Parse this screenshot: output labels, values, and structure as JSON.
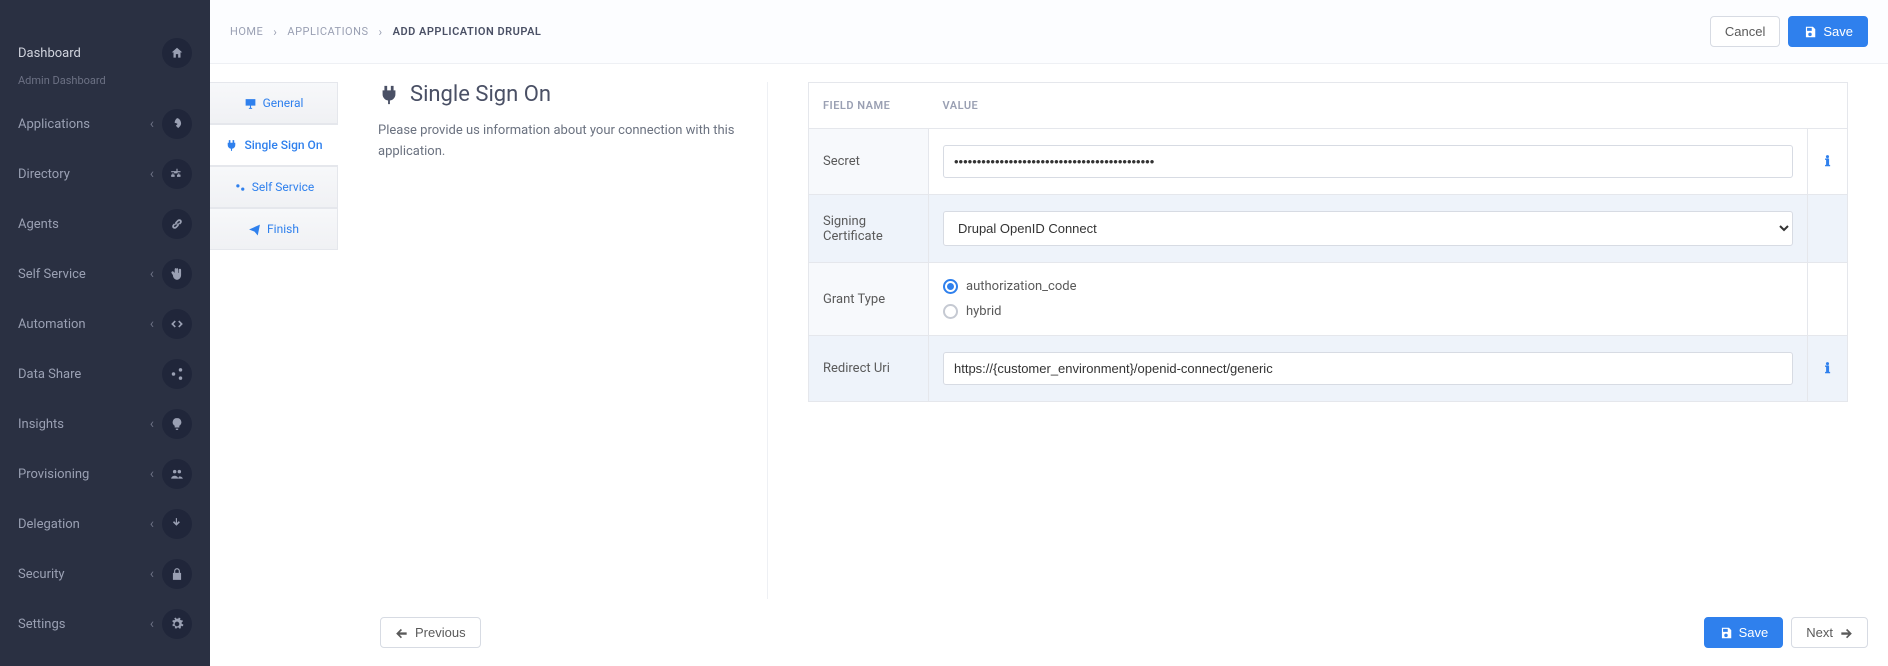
{
  "sidebar": {
    "header": {
      "title": "Dashboard",
      "subtitle": "Admin Dashboard"
    },
    "items": [
      {
        "label": "Applications",
        "icon": "rocket",
        "expandable": true
      },
      {
        "label": "Directory",
        "icon": "sitemap",
        "expandable": true
      },
      {
        "label": "Agents",
        "icon": "link",
        "expandable": false
      },
      {
        "label": "Self Service",
        "icon": "hand",
        "expandable": true
      },
      {
        "label": "Automation",
        "icon": "code",
        "expandable": true
      },
      {
        "label": "Data Share",
        "icon": "share",
        "expandable": false
      },
      {
        "label": "Insights",
        "icon": "bulb",
        "expandable": true
      },
      {
        "label": "Provisioning",
        "icon": "users",
        "expandable": true
      },
      {
        "label": "Delegation",
        "icon": "pointer",
        "expandable": true
      },
      {
        "label": "Security",
        "icon": "lock",
        "expandable": true
      },
      {
        "label": "Settings",
        "icon": "gear",
        "expandable": true
      }
    ]
  },
  "breadcrumb": {
    "items": [
      {
        "label": "HOME",
        "active": false
      },
      {
        "label": "APPLICATIONS",
        "active": false
      },
      {
        "label": "ADD APPLICATION DRUPAL",
        "active": true
      }
    ]
  },
  "topbar": {
    "cancel": "Cancel",
    "save": "Save"
  },
  "steps": [
    {
      "label": "General",
      "icon": "monitor",
      "active": false
    },
    {
      "label": "Single Sign On",
      "icon": "plug",
      "active": true
    },
    {
      "label": "Self Service",
      "icon": "cogs",
      "active": false
    },
    {
      "label": "Finish",
      "icon": "send",
      "active": false
    }
  ],
  "page": {
    "title": "Single Sign On",
    "description": "Please provide us information about your connection with this application.",
    "table_headers": {
      "field": "FIELD NAME",
      "value": "VALUE"
    },
    "fields": {
      "secret": {
        "label": "Secret",
        "value": "••••••••••••••••••••••••••••••••••••••••••••"
      },
      "signing_cert": {
        "label": "Signing Certificate",
        "value": "Drupal OpenID Connect"
      },
      "grant_type": {
        "label": "Grant Type",
        "options": [
          {
            "value": "authorization_code",
            "checked": true
          },
          {
            "value": "hybrid",
            "checked": false
          }
        ]
      },
      "redirect_uri": {
        "label": "Redirect Uri",
        "value": "https://{customer_environment}/openid-connect/generic"
      }
    }
  },
  "footer": {
    "previous": "Previous",
    "save": "Save",
    "next": "Next"
  }
}
